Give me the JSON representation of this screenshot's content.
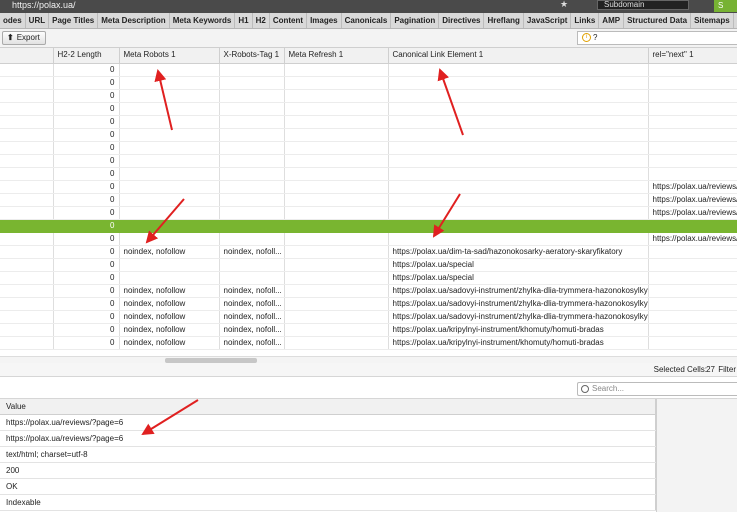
{
  "url_bar": {
    "url": "https://polax.ua/",
    "mode_label": "Subdomain",
    "go_label": "S"
  },
  "tabs": [
    "odes",
    "URL",
    "Page Titles",
    "Meta Description",
    "Meta Keywords",
    "H1",
    "H2",
    "Content",
    "Images",
    "Canonicals",
    "Pagination",
    "Directives",
    "Hreflang",
    "JavaScript",
    "Links",
    "AMP",
    "Structured Data",
    "Sitemaps",
    "PageSp"
  ],
  "toolbar": {
    "export_label": "Export",
    "help_label": "?"
  },
  "grid": {
    "columns": [
      "H2-2 Length",
      "Meta Robots 1",
      "X-Robots-Tag 1",
      "Meta Refresh 1",
      "Canonical Link Element 1",
      "rel=\"next\" 1"
    ],
    "rows": [
      [
        "0",
        "",
        "",
        "",
        "",
        ""
      ],
      [
        "0",
        "",
        "",
        "",
        "",
        ""
      ],
      [
        "0",
        "",
        "",
        "",
        "",
        ""
      ],
      [
        "0",
        "",
        "",
        "",
        "",
        ""
      ],
      [
        "0",
        "",
        "",
        "",
        "",
        ""
      ],
      [
        "0",
        "",
        "",
        "",
        "",
        ""
      ],
      [
        "0",
        "",
        "",
        "",
        "",
        ""
      ],
      [
        "0",
        "",
        "",
        "",
        "",
        ""
      ],
      [
        "0",
        "",
        "",
        "",
        "",
        ""
      ],
      [
        "0",
        "",
        "",
        "",
        "",
        "https://polax.ua/reviews/"
      ],
      [
        "0",
        "",
        "",
        "",
        "",
        "https://polax.ua/reviews/"
      ],
      [
        "0",
        "",
        "",
        "",
        "",
        "https://polax.ua/reviews/"
      ],
      [
        "0",
        "",
        "",
        "",
        "",
        ""
      ],
      [
        "0",
        "",
        "",
        "",
        "",
        "https://polax.ua/reviews/"
      ],
      [
        "0",
        "noindex, nofollow",
        "noindex, nofoll...",
        "",
        "https://polax.ua/dim-ta-sad/hazonokosarky-aeratory-skaryfikatory",
        ""
      ],
      [
        "0",
        "",
        "",
        "",
        "https://polax.ua/special",
        ""
      ],
      [
        "0",
        "",
        "",
        "",
        "https://polax.ua/special",
        ""
      ],
      [
        "0",
        "noindex, nofollow",
        "noindex, nofoll...",
        "",
        "https://polax.ua/sadovyi-instrument/zhylka-dlia-trymmera-hazonokosylky",
        ""
      ],
      [
        "0",
        "noindex, nofollow",
        "noindex, nofoll...",
        "",
        "https://polax.ua/sadovyi-instrument/zhylka-dlia-trymmera-hazonokosylky",
        ""
      ],
      [
        "0",
        "noindex, nofollow",
        "noindex, nofoll...",
        "",
        "https://polax.ua/sadovyi-instrument/zhylka-dlia-trymmera-hazonokosylky",
        ""
      ],
      [
        "0",
        "noindex, nofollow",
        "noindex, nofoll...",
        "",
        "https://polax.ua/kripylnyi-instrument/khomuty/homuti-bradas",
        ""
      ],
      [
        "0",
        "noindex, nofollow",
        "noindex, nofoll...",
        "",
        "https://polax.ua/kripylnyi-instrument/khomuty/homuti-bradas",
        ""
      ]
    ],
    "selected_row": 12
  },
  "status": {
    "selected_label": "Selected Cells:",
    "selected_count": "27",
    "filter_label": "Filter"
  },
  "detail": {
    "search_placeholder": "Search...",
    "header": "Value",
    "rows": [
      "https://polax.ua/reviews/?page=6",
      "https://polax.ua/reviews/?page=6",
      "text/html; charset=utf-8",
      "200",
      "OK",
      "Indexable"
    ]
  },
  "colors": {
    "selection": "#79b530",
    "annotation_arrow": "#e02020"
  }
}
